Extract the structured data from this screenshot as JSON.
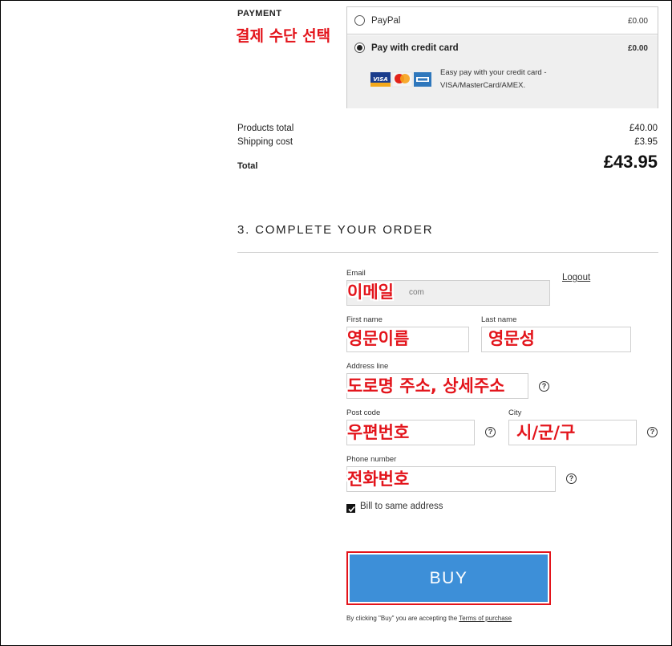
{
  "payment": {
    "section_label": "PAYMENT",
    "annotation": "결제 수단 선택",
    "methods": [
      {
        "name": "PayPal",
        "price": "£0.00",
        "selected": false
      },
      {
        "name": "Pay with credit card",
        "price": "£0.00",
        "selected": true,
        "description": "Easy pay with your credit card - VISA/MasterCard/AMEX."
      }
    ],
    "card_icons": [
      "visa-card-icon",
      "mastercard-icon",
      "amex-card-icon"
    ]
  },
  "totals": {
    "products_label": "Products total",
    "products_value": "£40.00",
    "shipping_label": "Shipping cost",
    "shipping_value": "£3.95",
    "total_label": "Total",
    "total_value": "£43.95"
  },
  "complete_order": {
    "title": "3. COMPLETE YOUR ORDER",
    "email": {
      "label": "Email",
      "value": "com",
      "annotation": "이메일"
    },
    "logout_label": "Logout",
    "first_name": {
      "label": "First name",
      "annotation": "영문이름"
    },
    "last_name": {
      "label": "Last name",
      "annotation": "영문성"
    },
    "address": {
      "label": "Address line",
      "annotation": "도로명 주소, 상세주소"
    },
    "post_code": {
      "label": "Post code",
      "annotation": "우편번호"
    },
    "city": {
      "label": "City",
      "annotation": "시/군/구"
    },
    "phone": {
      "label": "Phone number",
      "annotation": "전화번호"
    },
    "help_symbol": "?",
    "bill_same_label": "Bill to same address",
    "bill_same_checked": true,
    "buy_label": "BUY",
    "terms_prefix": "By clicking \"Buy\" you are accepting the ",
    "terms_link": "Terms of purchase"
  },
  "colors": {
    "accent_button": "#3d8fd8",
    "annotation_red": "#e3141b"
  }
}
